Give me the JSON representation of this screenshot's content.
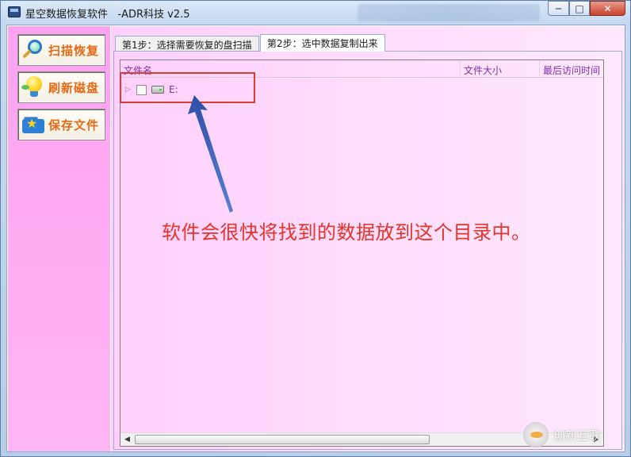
{
  "window": {
    "title": "星空数据恢复软件   -ADR科技 v2.5",
    "min_icon": "minimize-icon",
    "max_icon": "maximize-icon",
    "close_icon": "close-icon",
    "min_glyph": "─",
    "max_glyph": "□",
    "close_glyph": "✕"
  },
  "sidebar": {
    "scan_label": "扫描恢复",
    "refresh_label": "刷新磁盘",
    "save_label": "保存文件"
  },
  "tabs": {
    "step1": "第1步：选择需要恢复的盘扫描",
    "step2": "第2步：选中数据复制出来",
    "active": "step2"
  },
  "listview": {
    "columns": [
      "文件名",
      "文件大小",
      "最后访问时间"
    ],
    "rows": [
      {
        "label": "E:",
        "checked": false,
        "expanded": false
      }
    ]
  },
  "scrollbar": {
    "left_glyph": "◀",
    "right_glyph": "▶"
  },
  "annotation": {
    "text": "软件会很快将找到的数据放到这个目录中。",
    "color": "#e3342a"
  },
  "watermark": {
    "text": "创新互联"
  },
  "colors": {
    "sidebar_bg": "#ffa2f2",
    "button_label": "#e56a16",
    "column_header": "#7a2fb3",
    "highlight": "#d83d2f",
    "arrow": "#3b5fb5"
  }
}
